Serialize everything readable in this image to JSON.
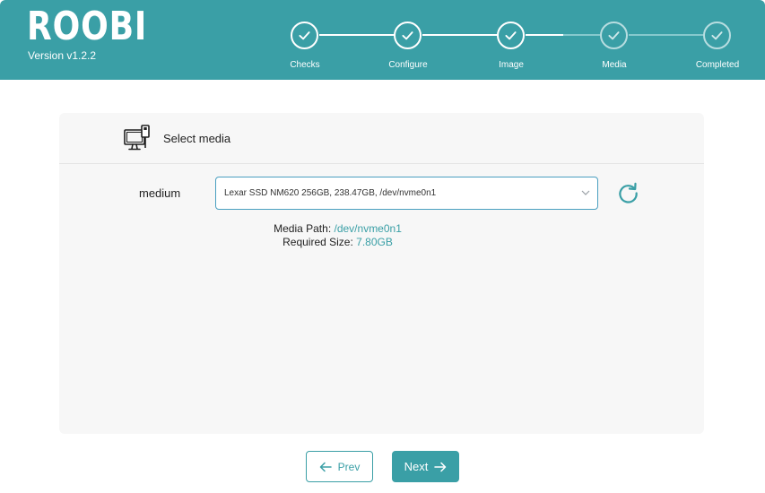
{
  "app": {
    "name": "ROOBI",
    "version": "Version v1.2.2"
  },
  "colors": {
    "accent": "#3a9fa6",
    "card_bg": "#f7f7f7",
    "select_border": "#4a9fc0"
  },
  "steps": [
    {
      "label": "Checks",
      "state": "done"
    },
    {
      "label": "Configure",
      "state": "done"
    },
    {
      "label": "Image",
      "state": "done"
    },
    {
      "label": "Media",
      "state": "pending"
    },
    {
      "label": "Completed",
      "state": "pending"
    }
  ],
  "card": {
    "icon": "computer-usb-icon",
    "title": "Select media",
    "field_label": "medium",
    "selected_media": "Lexar SSD NM620 256GB, 238.47GB, /dev/nvme0n1",
    "refresh_icon": "refresh-icon",
    "media_path_label": "Media Path:",
    "media_path_value": "/dev/nvme0n1",
    "required_size_label": "Required Size:",
    "required_size_value": "7.80GB"
  },
  "nav": {
    "prev_label": "Prev",
    "next_label": "Next"
  }
}
